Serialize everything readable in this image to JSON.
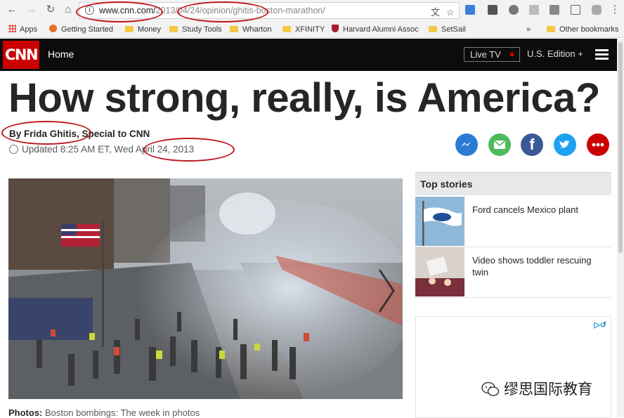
{
  "browser": {
    "url_host": "www.cnn.com/",
    "url_rest": "2013/04/24/opinion/ghitis-boston-marathon/",
    "bookmarks": [
      {
        "label": "Apps",
        "icon": "apps-grid-icon"
      },
      {
        "label": "Getting Started",
        "icon": "firefox-icon"
      },
      {
        "label": "Money",
        "icon": "folder-icon"
      },
      {
        "label": "Study Tools",
        "icon": "folder-icon"
      },
      {
        "label": "Wharton",
        "icon": "folder-icon"
      },
      {
        "label": "XFINITY",
        "icon": "folder-icon"
      },
      {
        "label": "Harvard Alumni Assoc",
        "icon": "harvard-shield-icon"
      },
      {
        "label": "SetSail",
        "icon": "folder-icon"
      }
    ],
    "more_bookmarks": "»",
    "other_bookmarks": "Other bookmarks"
  },
  "cnn_nav": {
    "logo": "CNN",
    "home": "Home",
    "live_tv": "Live TV",
    "edition": "U.S. Edition +"
  },
  "article": {
    "headline": "How strong, really, is America?",
    "byline": "By Frida Ghitis, Special to CNN",
    "updated": "Updated 8:25 AM ET, Wed April 24, 2013",
    "caption_label": "Photos:",
    "caption_text": "Boston bombings: The week in photos"
  },
  "share_icons": [
    {
      "name": "messenger-icon",
      "color": "#2b7bd5"
    },
    {
      "name": "email-icon",
      "color": "#4cbb5e"
    },
    {
      "name": "facebook-icon",
      "color": "#3b5998"
    },
    {
      "name": "twitter-icon",
      "color": "#1da1f2"
    },
    {
      "name": "more-icon",
      "color": "#cc0000"
    }
  ],
  "sidebar": {
    "heading": "Top stories",
    "stories": [
      {
        "title": "Ford cancels Mexico plant"
      },
      {
        "title": "Video shows toddler rescuing twin"
      }
    ]
  },
  "watermark": "缪思国际教育",
  "colors": {
    "cnn_red": "#cc0000",
    "annotation_red": "#c0161e",
    "nav_black": "#0c0c0c"
  }
}
